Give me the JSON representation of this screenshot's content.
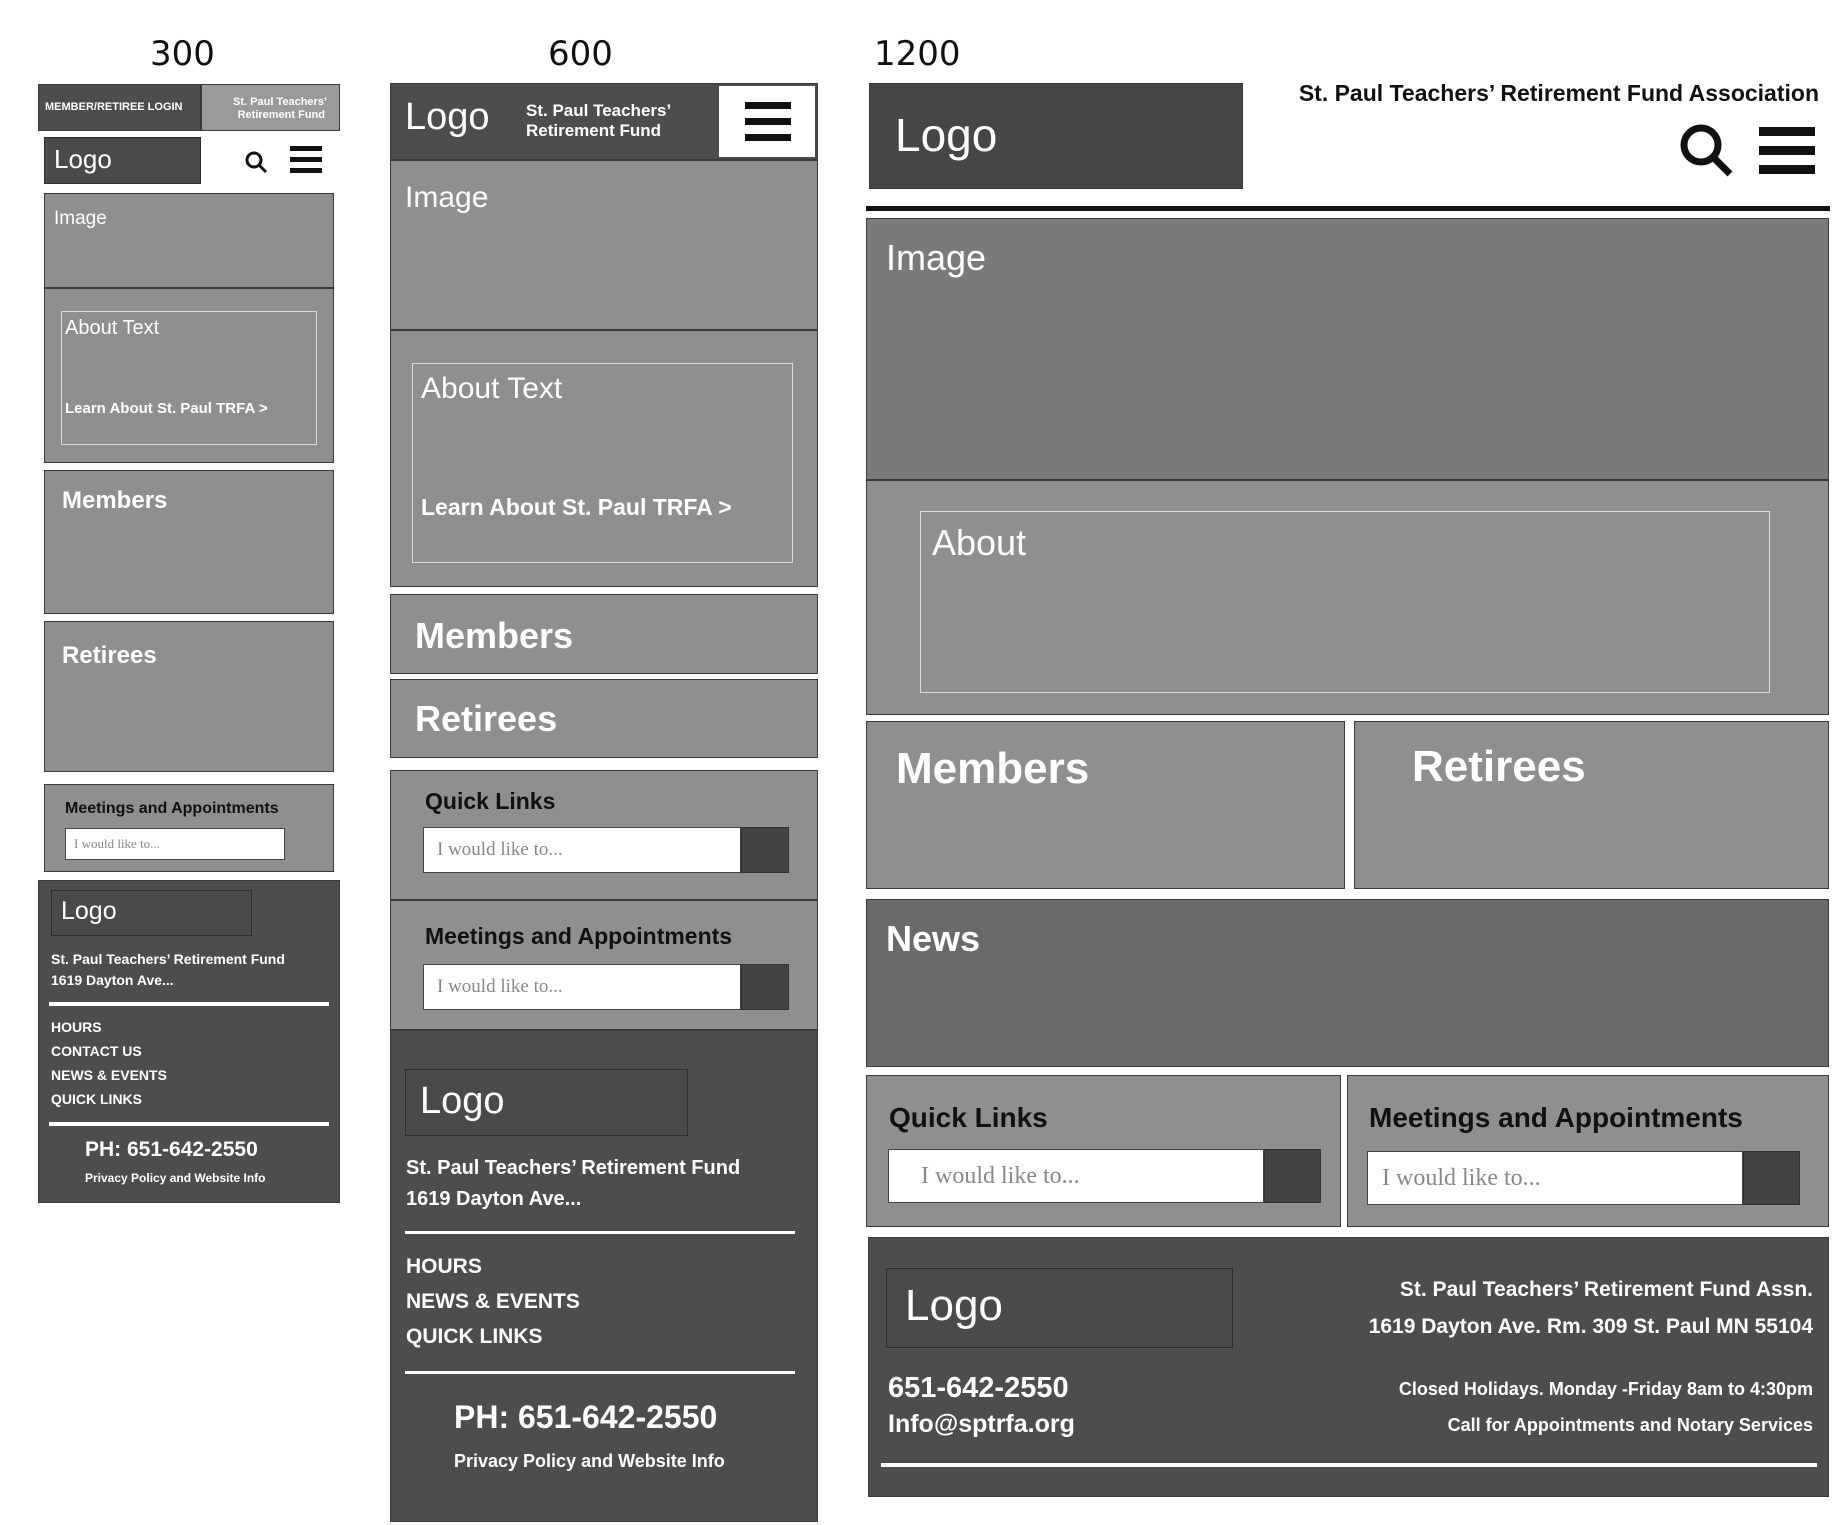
{
  "columns": {
    "c300": "300",
    "c600": "600",
    "c1200": "1200"
  },
  "m300": {
    "login": "MEMBER/RETIREE LOGIN",
    "org_line1": "St. Paul Teachers’",
    "org_line2": "Retirement Fund",
    "logo": "Logo",
    "image": "Image",
    "about": "About Text",
    "learn": "Learn About St. Paul TRFA >",
    "members": "Members",
    "retirees": "Retirees",
    "meetings": "Meetings and Appointments",
    "meetings_placeholder": "I would like to...",
    "footer_logo": "Logo",
    "footer_org": "St. Paul Teachers’ Retirement Fund",
    "footer_addr": "1619 Dayton Ave...",
    "links": [
      "HOURS",
      "CONTACT US",
      "NEWS & EVENTS",
      "QUICK LINKS"
    ],
    "phone": "PH: 651-642-2550",
    "privacy": "Privacy Policy and Website Info"
  },
  "m600": {
    "logo": "Logo",
    "org_line1": "St. Paul Teachers’",
    "org_line2": "Retirement Fund",
    "image": "Image",
    "about": "About Text",
    "learn": "Learn About St. Paul TRFA >",
    "members": "Members",
    "retirees": "Retirees",
    "quick_links": "Quick Links",
    "quick_placeholder": "I would like to...",
    "meetings": "Meetings and Appointments",
    "meetings_placeholder": "I would like to...",
    "footer_logo": "Logo",
    "footer_org": "St. Paul Teachers’ Retirement Fund",
    "footer_addr": "1619 Dayton Ave...",
    "links": [
      "HOURS",
      "NEWS & EVENTS",
      "QUICK LINKS"
    ],
    "phone": "PH: 651-642-2550",
    "privacy": "Privacy Policy and Website Info"
  },
  "d1200": {
    "logo": "Logo",
    "org": "St. Paul Teachers’ Retirement Fund Association",
    "image": "Image",
    "about": "About",
    "members": "Members",
    "retirees": "Retirees",
    "news": "News",
    "quick_links": "Quick Links",
    "quick_placeholder": "I would like to...",
    "meetings": "Meetings and Appointments",
    "meetings_placeholder": "I would like to...",
    "footer_logo": "Logo",
    "phone": "651-642-2550",
    "email": "Info@sptrfa.org",
    "footer_org": "St. Paul Teachers’ Retirement Fund Assn.",
    "footer_addr": "1619 Dayton Ave. Rm. 309 St. Paul MN 55104",
    "hours": "Closed Holidays. Monday -Friday 8am to 4:30pm",
    "appointments": "Call for Appointments and Notary Services"
  }
}
